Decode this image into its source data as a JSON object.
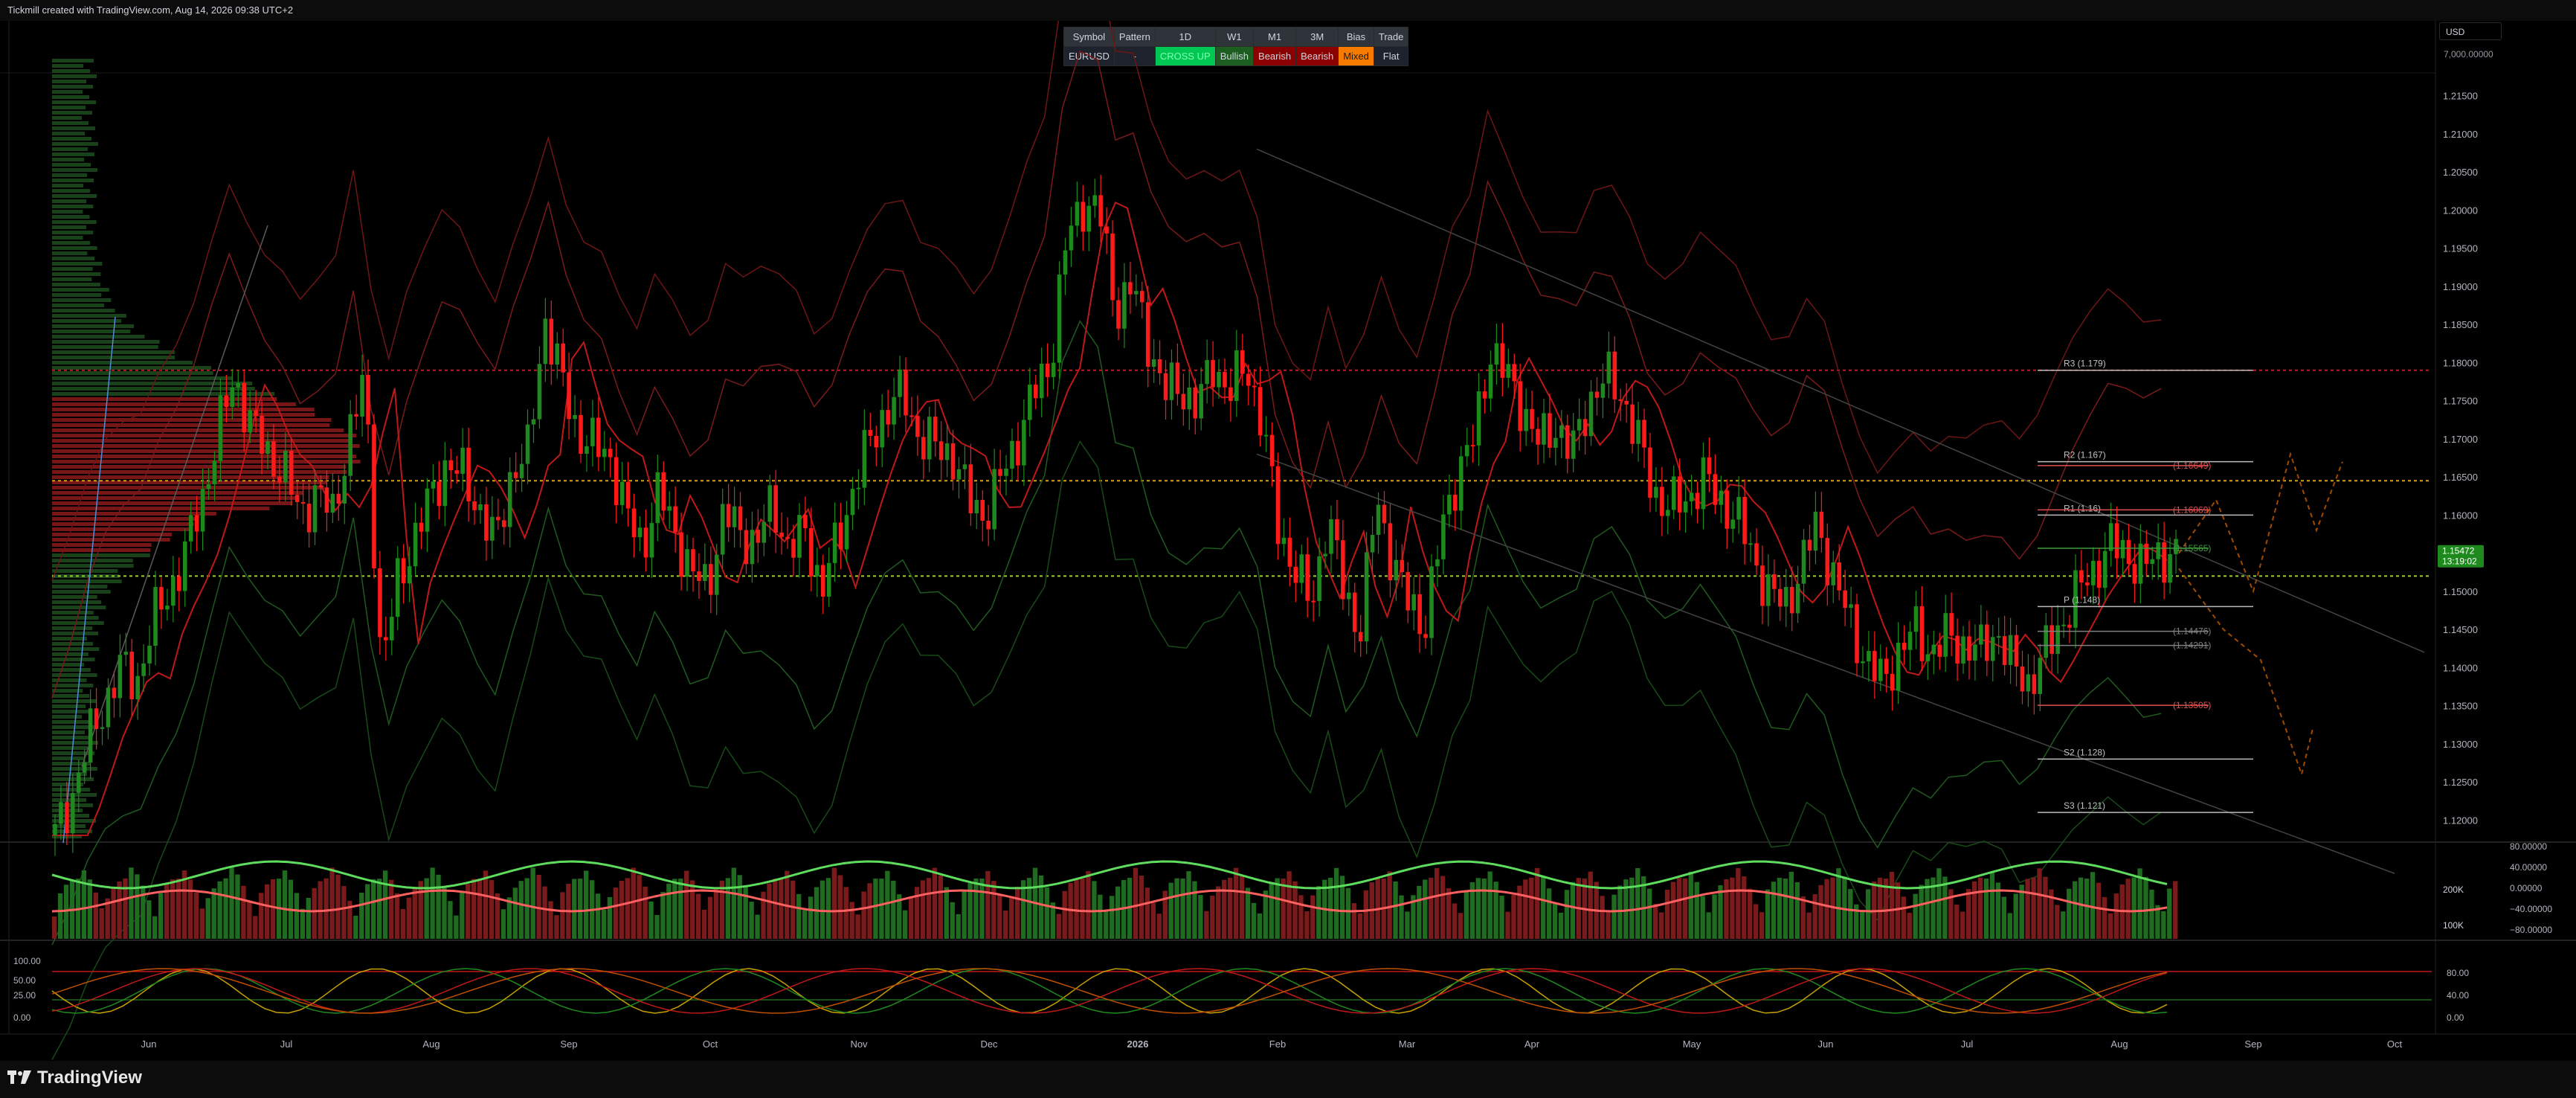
{
  "caption": "Tickmill created with TradingView.com, Aug 14, 2026 09:38 UTC+2",
  "brand": "TradingView",
  "currency": "USD",
  "top_value": "7,000.00000",
  "table": {
    "headers": [
      "Symbol",
      "Pattern",
      "1D",
      "W1",
      "M1",
      "3M",
      "Bias",
      "Trade"
    ],
    "values": [
      "EURUSD",
      "-",
      "CROSS UP",
      "Bullish",
      "Bearish",
      "Bearish",
      "Mixed",
      "Flat"
    ],
    "value_colors": [
      "#1e222d",
      "#1e222d",
      "#00c853",
      "#1b5e20",
      "#8b0000",
      "#8b0000",
      "#f57c00",
      "#1e222d"
    ],
    "value_text_colors": [
      "#d1d4dc",
      "#d1d4dc",
      "#80ffb0",
      "#d1d4dc",
      "#d1d4dc",
      "#d1d4dc",
      "#1a1a1a",
      "#d1d4dc"
    ]
  },
  "colors": {
    "up": "#1e8a1e",
    "down": "#ff1a1a",
    "bg": "#000000",
    "grid": "#111111"
  },
  "chart_data": [
    {
      "type": "line",
      "subtype": "candlestick",
      "symbol": "EURUSD",
      "ylim": [
        1.1175,
        1.218
      ],
      "y_ticks": [
        1.12,
        1.125,
        1.13,
        1.135,
        1.14,
        1.145,
        1.15,
        1.155,
        1.16,
        1.165,
        1.17,
        1.175,
        1.18,
        1.185,
        1.19,
        1.195,
        1.2,
        1.205,
        1.21,
        1.215
      ],
      "y_tick_labels": [
        "1.12000",
        "1.12500",
        "1.13000",
        "1.13500",
        "1.14000",
        "1.14500",
        "1.15000",
        "1.15500",
        "1.16000",
        "1.16500",
        "1.17000",
        "1.17500",
        "1.18000",
        "1.18500",
        "1.19000",
        "1.19500",
        "1.20000",
        "1.20500",
        "1.21000",
        "1.21500"
      ],
      "x_ticks": [
        "Jun",
        "Jul",
        "Aug",
        "Sep",
        "Oct",
        "Nov",
        "Dec",
        "2026",
        "Feb",
        "Mar",
        "Apr",
        "May",
        "Jun",
        "Jul",
        "Aug",
        "Sep",
        "Oct"
      ],
      "last_price": "1.15472",
      "countdown": "13:19:02",
      "close_path": [
        1.118,
        1.123,
        1.13,
        1.135,
        1.14,
        1.138,
        1.146,
        1.15,
        1.155,
        1.162,
        1.171,
        1.178,
        1.172,
        1.168,
        1.166,
        1.16,
        1.163,
        1.16,
        1.17,
        1.178,
        1.14,
        1.151,
        1.157,
        1.162,
        1.167,
        1.165,
        1.161,
        1.156,
        1.166,
        1.168,
        1.186,
        1.178,
        1.171,
        1.169,
        1.168,
        1.16,
        1.156,
        1.163,
        1.158,
        1.152,
        1.151,
        1.16,
        1.158,
        1.156,
        1.162,
        1.155,
        1.158,
        1.15,
        1.157,
        1.164,
        1.17,
        1.174,
        1.176,
        1.17,
        1.169,
        1.168,
        1.162,
        1.16,
        1.165,
        1.17,
        1.176,
        1.18,
        1.196,
        1.201,
        1.2,
        1.187,
        1.19,
        1.183,
        1.176,
        1.177,
        1.174,
        1.18,
        1.176,
        1.18,
        1.172,
        1.158,
        1.153,
        1.148,
        1.16,
        1.15,
        1.145,
        1.162,
        1.154,
        1.148,
        1.146,
        1.158,
        1.166,
        1.17,
        1.182,
        1.178,
        1.174,
        1.169,
        1.172,
        1.168,
        1.175,
        1.178,
        1.176,
        1.17,
        1.163,
        1.161,
        1.162,
        1.165,
        1.162,
        1.16,
        1.155,
        1.15,
        1.148,
        1.153,
        1.159,
        1.152,
        1.146,
        1.141,
        1.138,
        1.142,
        1.145,
        1.142,
        1.144,
        1.143,
        1.142,
        1.145,
        1.14,
        1.138,
        1.142,
        1.146,
        1.15,
        1.153,
        1.156,
        1.155,
        1.153,
        1.155,
        1.1547
      ],
      "levels": [
        {
          "label": "R3 (1.179)",
          "value": 1.179
        },
        {
          "label": "R2 (1.167)",
          "value": 1.167
        },
        {
          "label": "R1 (1.16)",
          "value": 1.16
        },
        {
          "label": "P (1.148)",
          "value": 1.148
        },
        {
          "label": "S2 (1.128)",
          "value": 1.128
        },
        {
          "label": "S3 (1.121)",
          "value": 1.121
        }
      ],
      "side_labels": [
        {
          "label": "(1.16649)",
          "value": 1.16649
        },
        {
          "label": "(1.16069)",
          "value": 1.16069
        },
        {
          "label": "(1.15565)",
          "value": 1.15565
        },
        {
          "label": "(1.14476)",
          "value": 1.14476
        },
        {
          "label": "(1.14291)",
          "value": 1.14291
        },
        {
          "label": "(1.13505)",
          "value": 1.13505
        }
      ],
      "horizontal_lines": [
        1.179,
        1.1645,
        1.152
      ]
    },
    {
      "type": "bar",
      "panel": "volume-oscillator",
      "right_ticks": [
        "80.00000",
        "40.00000",
        "0.00000",
        "−40.00000",
        "−80.00000"
      ],
      "volume_ticks": [
        "200K",
        "100K"
      ]
    },
    {
      "type": "line",
      "panel": "stochastic",
      "ylim": [
        0,
        100
      ],
      "left_ticks": [
        "100.00",
        "50.00",
        "25.00",
        "0.00"
      ],
      "right_ticks": [
        "80.00",
        "40.00",
        "0.00"
      ]
    }
  ]
}
